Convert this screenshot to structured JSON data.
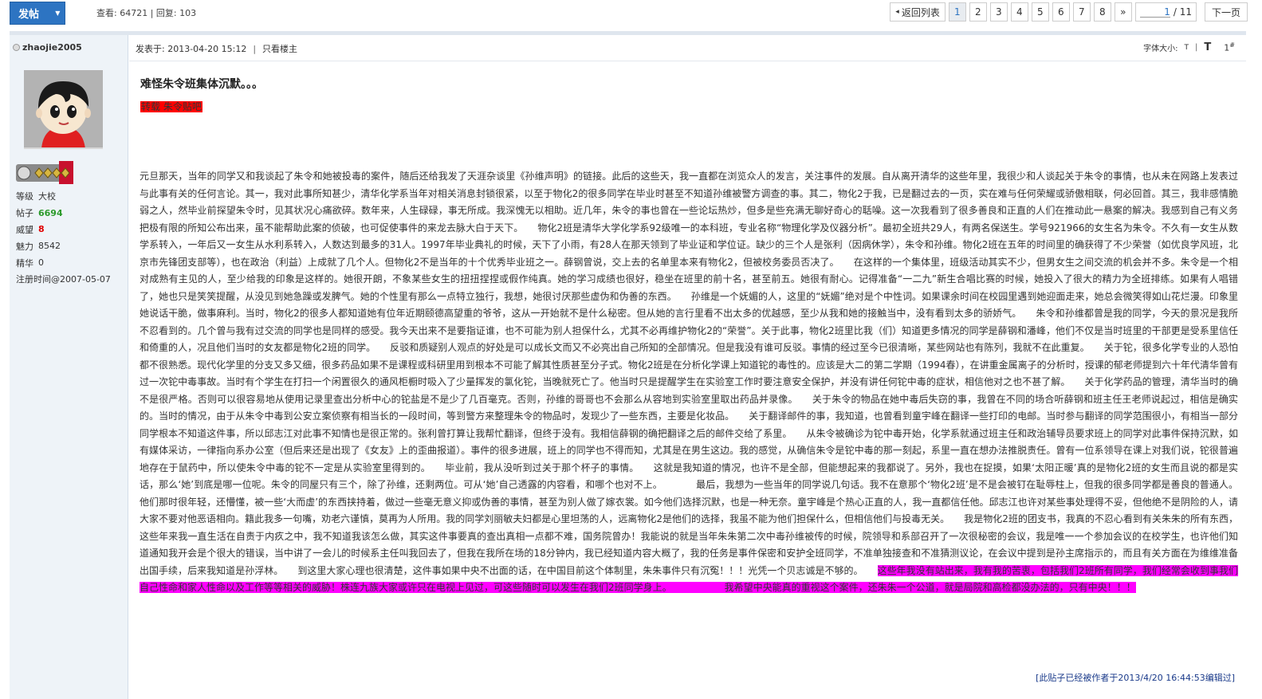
{
  "toolbar": {
    "post_label": "发帖",
    "views_replies": "查看: 64721 | 回复: 103"
  },
  "pager": {
    "back_label": "返回列表",
    "pages": [
      "1",
      "2",
      "3",
      "4",
      "5",
      "6",
      "7",
      "8"
    ],
    "current": "1",
    "more_label": "»",
    "input_value": "1",
    "total": "/ 11",
    "next_label": "下一页"
  },
  "author": {
    "username": "zhaojie2005",
    "fields": [
      {
        "key": "等级",
        "value": "大校"
      },
      {
        "key": "帖子",
        "value": "6694"
      },
      {
        "key": "威望",
        "value": "8"
      },
      {
        "key": "魅力",
        "value": "8542"
      },
      {
        "key": "精华",
        "value": "0"
      },
      {
        "key": "注册时间",
        "value": "@2007-05-07"
      }
    ]
  },
  "post": {
    "posted_at": "发表于: 2013-04-20 15:12",
    "only_author": "只看楼主",
    "font_size_label": "字体大小:",
    "font_small": "T",
    "font_large": "T",
    "floor": "1",
    "floor_mark": "#",
    "title": "难怪朱令班集体沉默。。。",
    "tag": "转载 朱令贴吧",
    "body": "元旦那天，当年的同学又和我谈起了朱令和她被投毒的案件，随后还给我发了天涯杂谈里《孙维声明》的链接。此后的这些天，我一直都在浏览众人的发言，关注事件的发展。自从离开清华的这些年里，我很少和人谈起关于朱令的事情，也从未在网路上发表过与此事有关的任何言论。其一，我对此事所知甚少，清华化学系当年对相关消息封锁很紧，以至于物化2的很多同学在毕业时甚至不知道孙维被警方调查的事。其二，物化2于我，已是翻过去的一页，实在难与任何荣耀或骄傲相联，何必回首。其三，我非感情脆弱之人，然毕业前探望朱令时，见其状况心痛欲碎。数年来，人生碌碌，事无所成。我深愧无以相助。近几年，朱令的事也曾在一些论坛热炒，但多是些充满无聊好奇心的聒噪。这一次我看到了很多善良和正直的人们在推动此一悬案的解决。我感到自己有义务把极有限的所知公布出来，虽不能帮助此案的侦破，也可促使事件的来龙去脉大白于天下。　　物化2班是清华大学化学系92级唯一的本科班，专业名称“物理化学及仪器分析”。最初全班共29人，有两名保送生。学号921966的女生名为朱令。不久有一女生从数学系转入，一年后又一女生从水利系转入，人数达到最多的31人。1997年毕业典礼的时候，天下了小雨，有28人在那天领到了毕业证和学位证。缺少的三个人是张利（因病休学），朱令和孙维。物化2班在五年的时间里的确获得了不少荣誉（如优良学风班，北京市先锋团支部等），也在政治（利益）上成就了几个人。但物化2不是当年的十个优秀毕业班之一。薛钢曾说，交上去的名单里本来有物化2，但被校务委员否决了。　　在这样的一个集体里，班级活动其实不少，但男女生之间交流的机会并不多。朱令是一个相对成熟有主见的人，至少给我的印象是这样的。她很开朗，不象某些女生的扭扭捏捏或假作纯真。她的学习成绩也很好，稳坐在班里的前十名，甚至前五。她很有耐心。记得准备“一二九”新生合唱比赛的时候，她投入了很大的精力为全班排练。如果有人唱错了，她也只是笑笑提醒，从没见到她急躁或发脾气。她的个性里有那么一点特立独行，我想，她很讨厌那些虚伪和伪善的东西。　　孙维是一个妩媚的人，这里的“妩媚”绝对是个中性词。如果课余时间在校园里遇到她迎面走来，她总会微笑得如山花烂漫。印象里她说话干脆，做事麻利。当时，物化2的很多人都知道她有位年近期颐德高望重的爷爷，这从一开始就不是什么秘密。但从她的言行里看不出太多的优越感，至少从我和她的接触当中，没有看到太多的骄娇气。　　朱令和孙维都曾是我的同学，今天的景况是我所不忍看到的。几个曾与我有过交流的同学也是同样的感受。我今天出来不是要指证谁，也不可能为别人担保什么，尤其不必再维护物化2的“荣誉”。关于此事，物化2班里比我（们）知道更多情况的同学是薛钢和潘峰，他们不仅是当时班里的干部更是受系里信任和倚重的人，况且他们当时的女友都是物化2班的同学。　　反驳和质疑别人观点的好处是可以成长文而又不必亮出自己所知的全部情况。但是我没有谁可反驳。事情的经过至今已很清晰，某些网站也有陈列，我就不在此重复。　　关于铊，很多化学专业的人恐怕都不很熟悉。现代化学里的分支又多又细，很多药品如果不是课程或科研里用到根本不可能了解其性质甚至分子式。物化2班是在分析化学课上知道铊的毒性的。应该是大二的第二学期（1994春），在讲重金属离子的分析时，授课的郁老师提到六十年代清华曾有过一次铊中毒事故。当时有个学生在打扫一个闲置很久的通风柜橱时吸入了少量挥发的氯化铊，当晚就死亡了。他当时只是提醒学生在实验室工作时要注意安全保护，并没有讲任何铊中毒的症状，相信他对之也不甚了解。　　关于化学药品的管理，清华当时的确不是很严格。否则可以很容易地从使用记录里查出分析中心的铊盐是不是少了几百毫克。否则，孙维的哥哥也不会那么从容地到实验室里取出药品并录像。　　关于朱令的物品在她中毒后失窃的事，我曾在不同的场合听薛钢和班主任王老师说起过，相信是确实的。当时的情况，由于从朱令中毒到公安立案侦察有相当长的一段时间，等到警方来整理朱令的物品时，发现少了一些东西，主要是化妆品。　　关于翻译邮件的事，我知道，也曾看到童宇峰在翻译一些打印的电邮。当时参与翻译的同学范围很小，有相当一部分同学根本不知道这件事，所以邱志江对此事不知情也是很正常的。张利曾打算让我帮忙翻译，但终于没有。我相信薛钢的确把翻译之后的邮件交给了系里。　　从朱令被确诊为铊中毒开始，化学系就通过班主任和政治辅导员要求班上的同学对此事件保持沉默，如有媒体采访，一律指向系办公室（但后来还是出现了《女友》上的歪曲报道）。事件的很多进展，班上的同学也不得而知，尤其是在男生这边。我的感觉，从确信朱令是铊中毒的那一刻起，系里一直在想办法推脱责任。曾有一位系领导在课上对我们说，铊很普遍地存在于鼠药中，所以使朱令中毒的铊不一定是从实验室里得到的。　　毕业前，我从没听到过关于那个杯子的事情。　　这就是我知道的情况，也许不是全部，但能想起来的我都说了。另外，我也在捉摸，如果‘太阳正暖’真的是物化2班的女生而且说的都是实话，那么‘她’到底是哪一位呢。朱令的同屋只有三个，除了孙维，还剩两位。可从‘她’自己透露的内容看，和哪个也对不上。　　　　最后，我想为一些当年的同学说几句话。我不在意那个‘物化2班’是不是会被钉在耻辱柱上，但我的很多同学都是善良的普通人。他们那时很年轻，还懵懂，被一些‘大而虚’的东西挟持着，做过一些毫无意义抑或伪善的事情，甚至为别人做了嫁衣裳。如今他们选择沉默，也是一种无奈。童宇峰是个热心正直的人，我一直都信任他。邱志江也许对某些事处理得不妥，但他绝不是阴险的人，请大家不要对他恶语相向。籍此我多一句嘴，劝老六谨慎，莫再为人所用。我的同学刘丽敏夫妇都是心里坦荡的人，远离物化2是他们的选择，我虽不能为他们担保什么，但相信他们与投毒无关。　　我是物化2班的团支书，我真的不忍心看到有关朱朱的所有东西，这些年来我一直生活在自责于内疚之中，我不知道我该怎么做，其实这件事要真的查出真相一点都不难，国务院曾办！我能说的就是当年朱朱第二次中毒孙维被传的时候，院领导和系部召开了一次很秘密的会议，我是唯一一个参加会议的在校学生，也许他们知道通知我开会是个很大的错误，当中讲了一会儿的时候系主任叫我回去了，但我在我所在场的18分钟内，我已经知道内容大概了，我的任务是事件保密和安护全班同学，不准单独接查和不准猜测议论，在会议中提到是孙主席指示的，而且有关方面在为维维准备出国手续，后来我知道是孙浮林。　　到这里大家心理也很清楚，这件事如果中央不出面的话，在中国目前这个体制里，朱朱事件只有沉冤！！！光凭一个贝志诚是不够的。　　",
    "body_highlight": "这些年我没有站出来，我有我的苦衷，包括我们2班所有同学，我们经常会收到事我们自己性命和家人性命以及工作等等相关的威胁！株连九族大家或许只在电视上见过，可这些随时可以发生在我们2班同学身上。　　　　　　我希望中央能真的重视这个案件，还朱朱一个公道，就是局院和高检都没办法的，只有中央！！！",
    "edit_note": "[此贴子已经被作者于2013/4/20 16:44:53编辑过]"
  },
  "colors": {
    "accent": "#2d74c2",
    "sidebar_bg": "#eef3f8",
    "tag_bg": "#ff0000",
    "highlight_bg": "#ff00ff"
  }
}
